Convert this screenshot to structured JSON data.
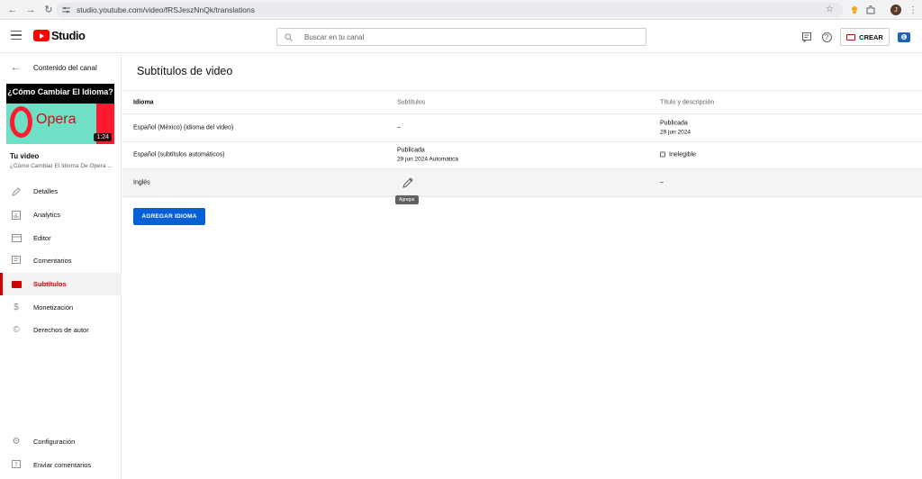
{
  "browser": {
    "url": "studio.youtube.com/video/fRSJeszNnQk/translations",
    "profile_initial": "J"
  },
  "header": {
    "logo_text": "Studio",
    "search_placeholder": "Buscar en tu canal",
    "create_label": "CREAR"
  },
  "sidebar": {
    "back_label": "Contenido del canal",
    "thumbnail": {
      "title": "¿Cómo Cambiar El Idioma?",
      "brand": "Opera",
      "duration": "1:24"
    },
    "your_video_label": "Tu video",
    "video_title": "¿Cómo Cambiar El Idioma De Opera ...",
    "items": [
      {
        "label": "Detalles",
        "icon": "pencil-icon"
      },
      {
        "label": "Analytics",
        "icon": "analytics-icon"
      },
      {
        "label": "Editor",
        "icon": "editor-icon"
      },
      {
        "label": "Comentarios",
        "icon": "comments-icon"
      },
      {
        "label": "Subtítulos",
        "icon": "subtitles-icon",
        "active": true
      },
      {
        "label": "Monetización",
        "icon": "dollar-icon"
      },
      {
        "label": "Derechos de autor",
        "icon": "copyright-icon"
      }
    ],
    "bottom_items": [
      {
        "label": "Configuración",
        "icon": "gear-icon"
      },
      {
        "label": "Enviar comentarios",
        "icon": "feedback-icon"
      }
    ]
  },
  "main": {
    "title": "Subtítulos de video",
    "columns": [
      "Idioma",
      "Subtítulos",
      "Título y descripción"
    ],
    "rows": [
      {
        "language": "Español (México) (idioma del video)",
        "subtitles": "–",
        "title_desc_l1": "Publicada",
        "title_desc_l2": "29 jun 2024"
      },
      {
        "language": "Español (subtítulos automáticos)",
        "subtitles_l1": "Publicada",
        "subtitles_l2": "29 jun 2024 Automática",
        "title_desc": "Inelegible"
      },
      {
        "language": "Inglés",
        "title_desc": "–",
        "tooltip": "Agregar"
      }
    ],
    "add_language_label": "AGREGAR IDIOMA"
  },
  "colors": {
    "accent_red": "#cc0000",
    "primary_blue": "#065fd4"
  }
}
